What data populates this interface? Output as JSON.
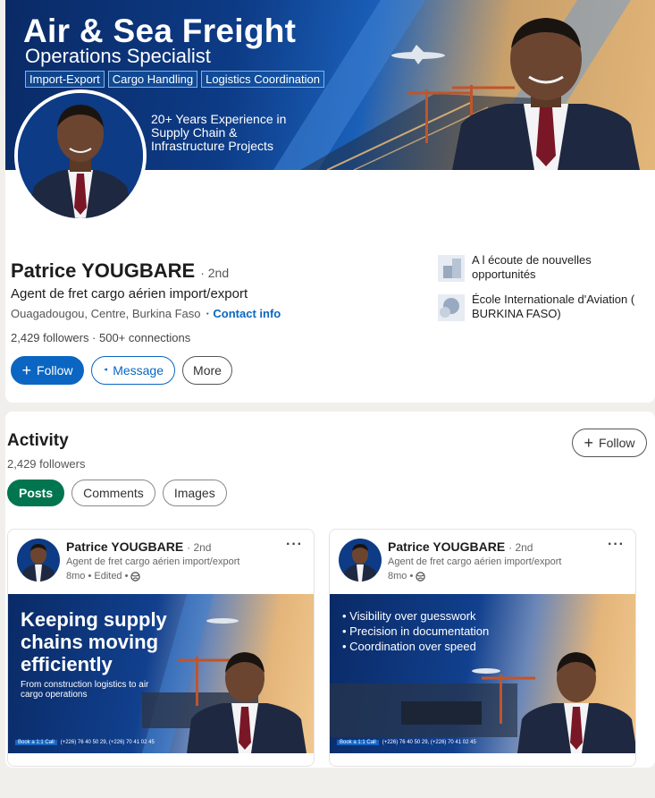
{
  "banner": {
    "title": "Air & Sea Freight",
    "subtitle": "Operations Specialist",
    "tags": [
      "Import-Export",
      "Cargo Handling",
      "Logistics Coordination"
    ],
    "experience": "20+ Years Experience in Supply Chain & Infrastructure Projects"
  },
  "profile": {
    "name": "Patrice YOUGBARE",
    "degree": "· 2nd",
    "headline": "Agent de fret cargo aérien import/export",
    "location": "Ouagadougou, Centre, Burkina Faso",
    "contact_link": "· Contact info",
    "stats": "2,429 followers · 500+ connections",
    "side_items": [
      {
        "text": "A l écoute de nouvelles opportunités",
        "icon": "briefcase-icon"
      },
      {
        "text": "École Internationale d'Aviation ( BURKINA FASO)",
        "icon": "school-icon"
      }
    ]
  },
  "actions": {
    "follow": "Follow",
    "message": "Message",
    "more": "More"
  },
  "activity": {
    "title": "Activity",
    "followers": "2,429 followers",
    "follow": "Follow",
    "tabs": [
      "Posts",
      "Comments",
      "Images"
    ],
    "active_tab": "Posts"
  },
  "posts": [
    {
      "author": "Patrice YOUGBARE",
      "degree": "· 2nd",
      "headline": "Agent de fret cargo aérien import/export",
      "meta": "8mo • Edited •",
      "image_title": "Keeping supply chains moving efficiently",
      "image_subtitle": "From construction logistics to air cargo operations",
      "footer_badge": "Book a 1:1 Call",
      "footer_phone": "(+226) 76 40 50 29,  (+226) 70 41 02 45"
    },
    {
      "author": "Patrice YOUGBARE",
      "degree": "· 2nd",
      "headline": "Agent de fret cargo aérien import/export",
      "meta": "8mo •",
      "bullets": [
        "Visibility over guesswork",
        "Precision in documentation",
        "Coordination over speed"
      ],
      "footer_badge": "Book a 1:1 Call",
      "footer_phone": "(+226) 76 40 50 29,  (+226) 70 41 02 45"
    }
  ],
  "colors": {
    "brand_blue": "#0a66c2",
    "active_green": "#01754f",
    "banner_navy": "#0a2a66"
  }
}
